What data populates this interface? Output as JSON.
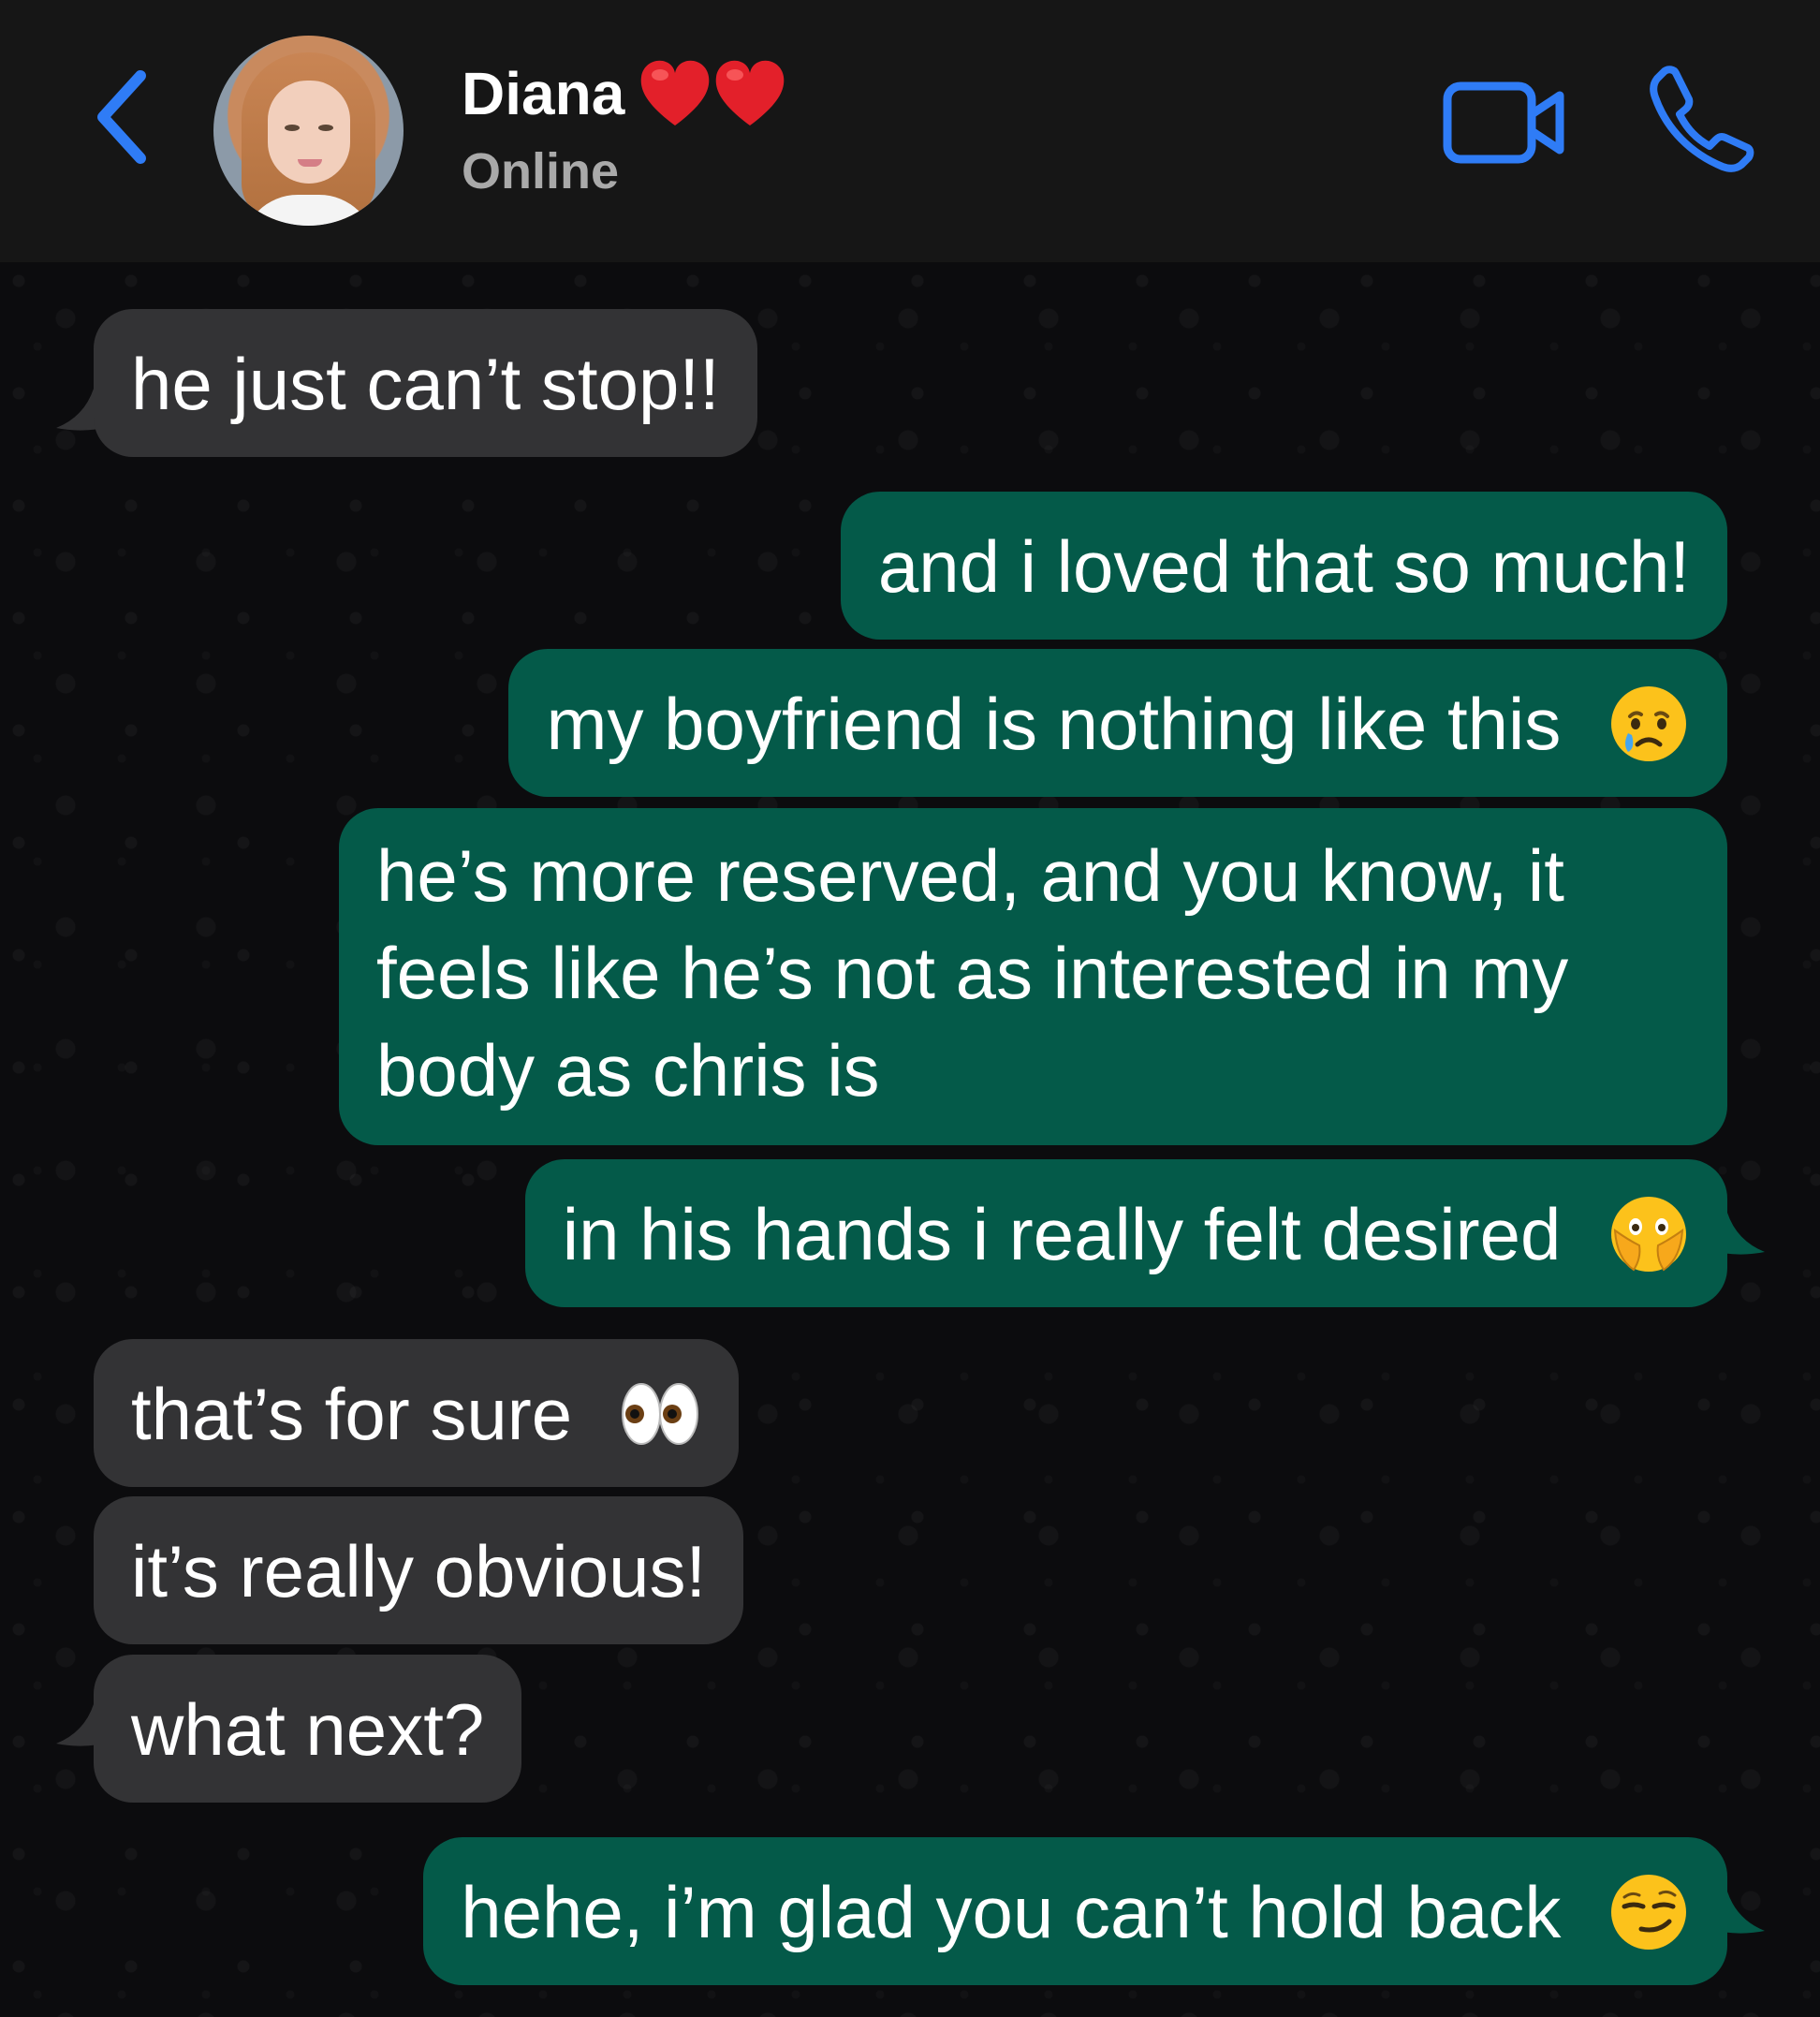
{
  "header": {
    "contact_name": "Diana",
    "status": "Online",
    "icons": [
      "back-chevron-icon",
      "heart-icon",
      "heart-icon",
      "video-call-icon",
      "phone-call-icon"
    ]
  },
  "messages": [
    {
      "direction": "incoming",
      "text": "he just can’t stop!!"
    },
    {
      "direction": "outgoing",
      "text": "and i loved that so much!"
    },
    {
      "direction": "outgoing",
      "text": "my boyfriend is nothing like this",
      "emoji": "crying-face"
    },
    {
      "direction": "outgoing",
      "lines": [
        "he’s more reserved, and you know, it",
        "feels like he’s not as interested in my",
        "body as chris is"
      ]
    },
    {
      "direction": "outgoing",
      "text": "in his hands i really felt desired",
      "emoji": "face-with-open-eyes-and-hand-over-mouth"
    },
    {
      "direction": "incoming",
      "text": "that’s for sure",
      "emoji": "eyes"
    },
    {
      "direction": "incoming",
      "text": "it’s really obvious!"
    },
    {
      "direction": "incoming",
      "text": "what next?"
    },
    {
      "direction": "outgoing",
      "text": "hehe, i’m glad you can’t hold back",
      "emoji": "smirking-face"
    }
  ],
  "colors": {
    "header_bg": "#161616",
    "chat_bg": "#0c0c0e",
    "incoming_bubble": "#333335",
    "outgoing_bubble": "#045a49",
    "accent_blue": "#2f7cf6",
    "status_gray": "#a9a9a9"
  }
}
